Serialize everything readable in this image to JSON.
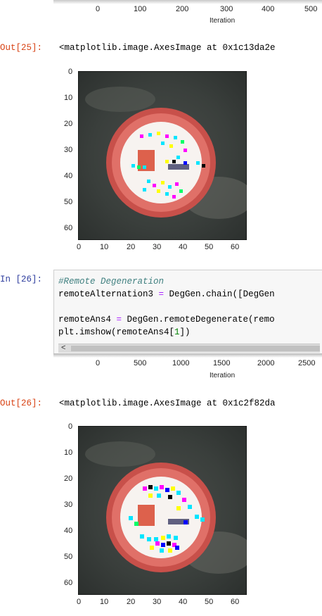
{
  "top_axis": {
    "ticks": [
      "0",
      "100",
      "200",
      "300",
      "400",
      "500"
    ],
    "label": "Iteration"
  },
  "out25": {
    "prompt": "Out[25]:",
    "text": "<matplotlib.image.AxesImage at 0x1c13da2e"
  },
  "img1": {
    "y_ticks": [
      "0",
      "10",
      "20",
      "30",
      "40",
      "50",
      "60"
    ],
    "x_ticks": [
      "0",
      "10",
      "20",
      "30",
      "40",
      "50",
      "60"
    ]
  },
  "in26": {
    "prompt": "In [26]:",
    "comment": "#Remote Degeneration",
    "line2_a": "remoteAlternation3 ",
    "line2_op": "=",
    "line2_b": " DegGen.chain([DegGen",
    "line3_a": "remoteAns4 ",
    "line3_op": "=",
    "line3_b": " DegGen.remoteDegenerate(remo",
    "line4_a": "plt.imshow(remoteAns4[",
    "line4_num": "1",
    "line4_b": "])",
    "scroll_left": "<"
  },
  "mid_axis": {
    "ticks": [
      "0",
      "500",
      "1000",
      "1500",
      "2000",
      "2500"
    ],
    "label": "Iteration"
  },
  "out26": {
    "prompt": "Out[26]:",
    "text": "<matplotlib.image.AxesImage at 0x1c2f82da"
  },
  "img2": {
    "y_ticks": [
      "0",
      "10",
      "20",
      "30",
      "40",
      "50",
      "60"
    ],
    "x_ticks": [
      "0",
      "10",
      "20",
      "30",
      "40",
      "50",
      "60"
    ]
  }
}
